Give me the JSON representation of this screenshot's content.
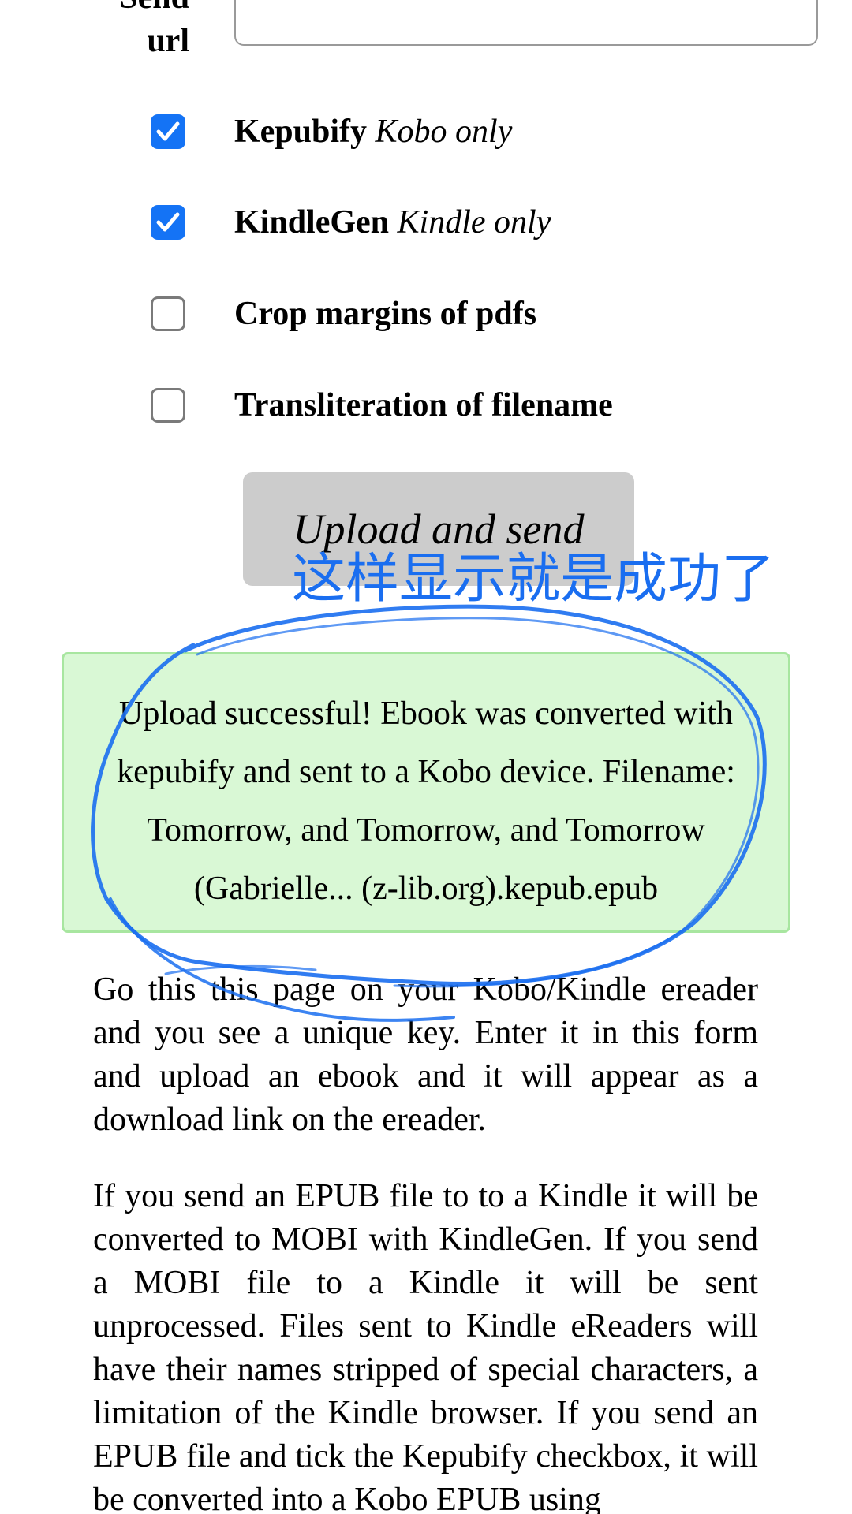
{
  "form": {
    "url_label_line1": "Send",
    "url_label_line2": "url",
    "url_value": "",
    "options": [
      {
        "name": "Kepubify",
        "note": "Kobo only",
        "checked": true
      },
      {
        "name": "KindleGen",
        "note": "Kindle only",
        "checked": true
      },
      {
        "name": "Crop margins of pdfs",
        "note": "",
        "checked": false
      },
      {
        "name": "Transliteration of filename",
        "note": "",
        "checked": false
      }
    ],
    "upload_button": "Upload and send"
  },
  "annotation": {
    "text": "这样显示就是成功了",
    "color": "#1a6ef0"
  },
  "status": {
    "message": "Upload successful! Ebook was converted with kepubify and sent to a Kobo device. Filename: Tomorrow, and Tomorrow, and Tomorrow (Gabrielle... (z-lib.org).kepub.epub",
    "background": "#d9f8d5"
  },
  "content": {
    "paragraph1": "Go this this page on your Kobo/Kindle ereader and you see a unique key. Enter it in this form and upload an ebook and it will appear as a download link on the ereader.",
    "paragraph2": "If you send an EPUB file to to a Kindle it will be converted to MOBI with KindleGen. If you send a MOBI file to a Kindle it will be sent unprocessed. Files sent to Kindle eReaders will have their names stripped of special characters, a limitation of the Kindle browser. If you send an EPUB file and tick the Kepubify checkbox, it will be converted into a Kobo EPUB using"
  },
  "colors": {
    "checkbox_checked": "#1473f5",
    "button_bg": "#cccccc"
  }
}
